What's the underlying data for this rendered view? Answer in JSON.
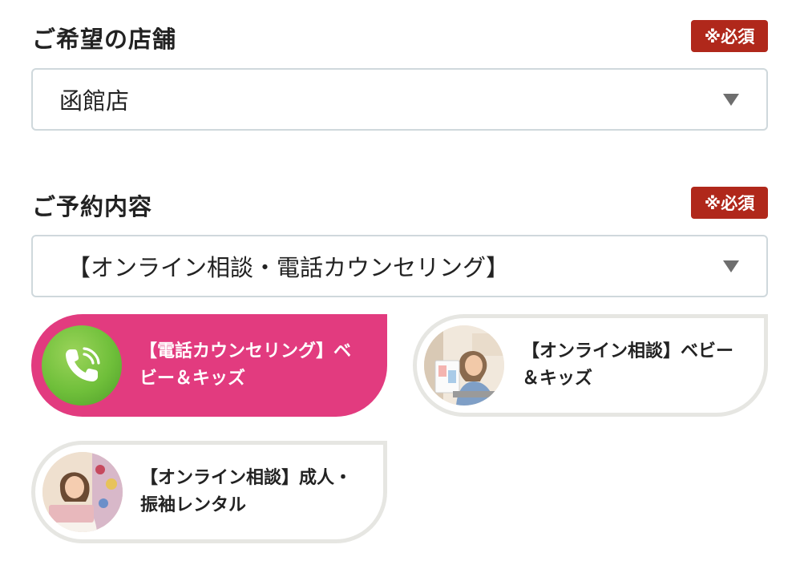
{
  "store_field": {
    "label": "ご希望の店舗",
    "required": "※必須",
    "selected": "函館店"
  },
  "reservation_field": {
    "label": "ご予約内容",
    "required": "※必須",
    "selected": "【オンライン相談・電話カウンセリング】"
  },
  "options": [
    {
      "line1": "【電話カウンセリング】ベ",
      "line2": "ビー＆キッズ",
      "icon": "phone-icon",
      "selected": true
    },
    {
      "line1": "【オンライン相談】ベビー",
      "line2": "＆キッズ",
      "icon": "photo-woman-laptop",
      "selected": false
    },
    {
      "line1": "【オンライン相談】成人・",
      "line2": "振袖レンタル",
      "icon": "photo-woman-kimono",
      "selected": false
    }
  ],
  "colors": {
    "accent_pink": "#e23b7f",
    "required_red": "#b0281b",
    "phone_green": "#6fbf3a",
    "border_gray": "#cfd8dc"
  }
}
